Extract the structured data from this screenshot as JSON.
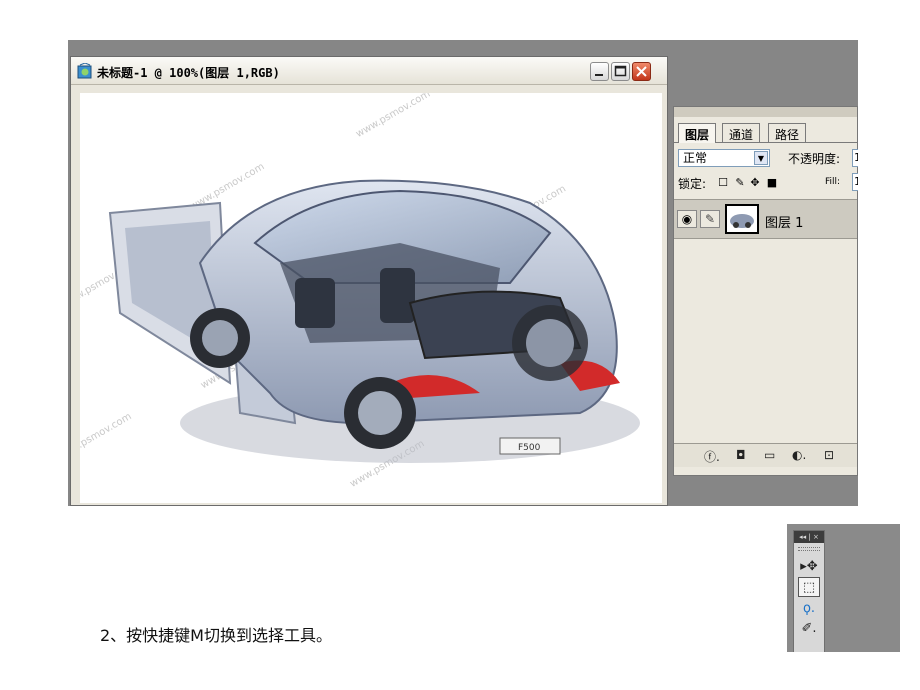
{
  "document_window": {
    "title": "未标题-1 @ 100%(图层 1,RGB)",
    "watermark": "www.psmov.com"
  },
  "layers_panel": {
    "tabs": [
      "图层",
      "通道",
      "路径"
    ],
    "blend_mode": "正常",
    "opacity_label": "不透明度:",
    "opacity_value": "1",
    "lock_label": "锁定:",
    "fill_label": "Fill:",
    "fill_value": "1",
    "layer_name": "图层 1"
  },
  "caption": "2、按快捷键M切换到选择工具。",
  "toolbox": {
    "header": "◂◂ | ×",
    "tools": [
      "move-tool",
      "rectangular-marquee-tool",
      "lasso-tool",
      "quick-selection-tool"
    ]
  },
  "colors": {
    "workspace_gray": "#868686",
    "panel_bg": "#ece9df",
    "close_button": "#c2361a"
  }
}
